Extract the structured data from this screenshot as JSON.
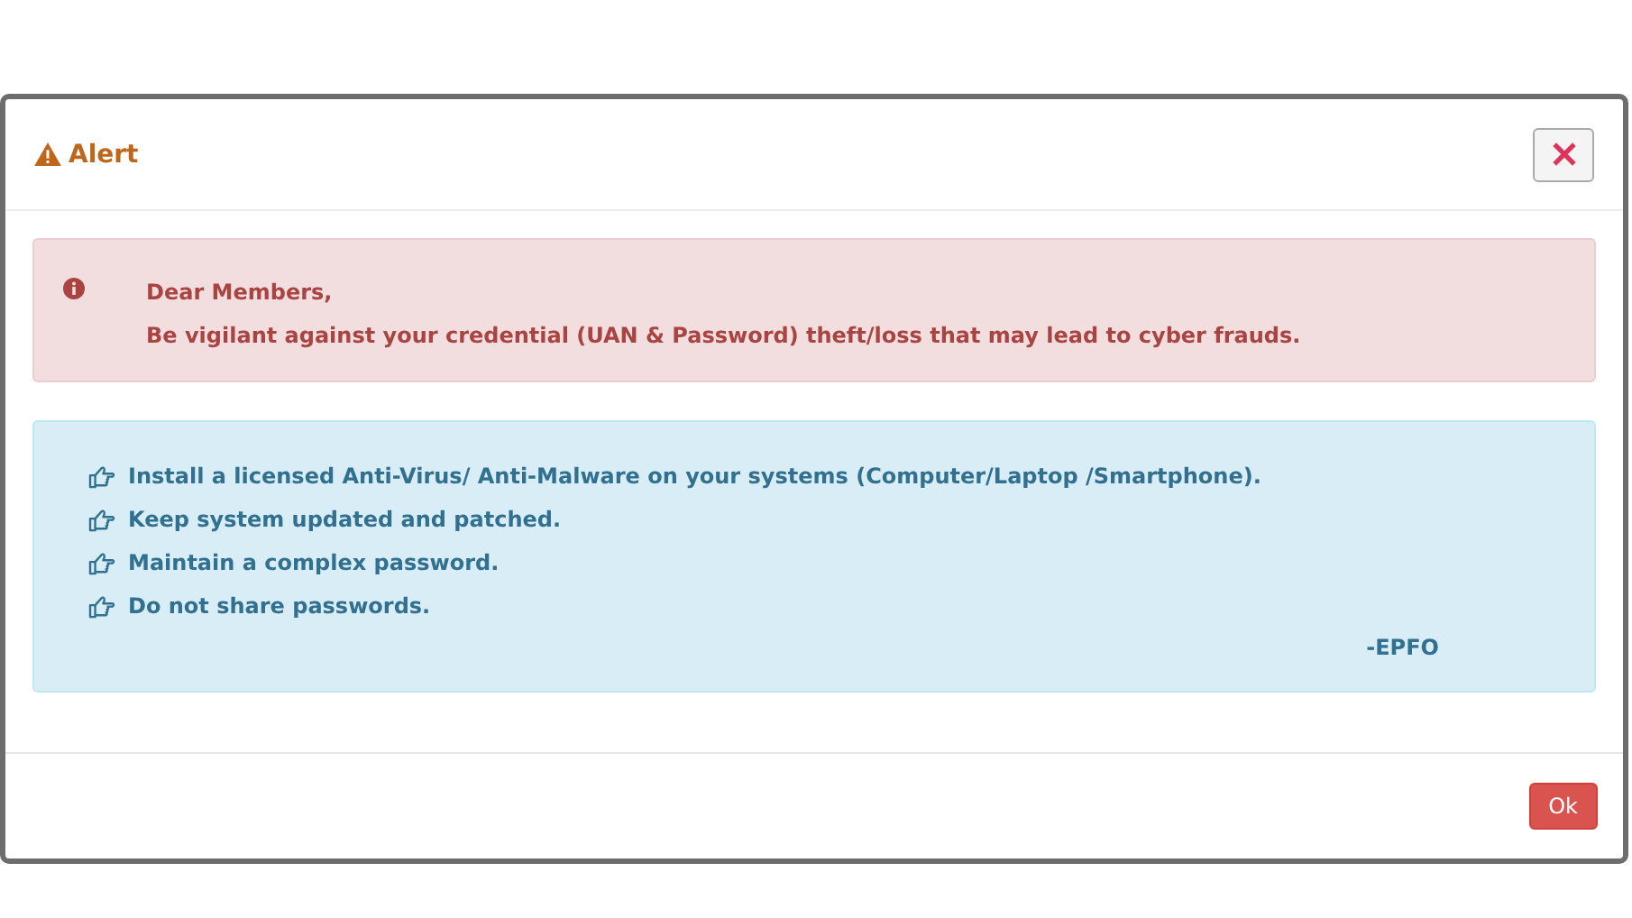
{
  "dialog": {
    "title": "Alert",
    "danger_alert": {
      "lines": [
        "Dear Members,",
        "Be vigilant against your credential (UAN & Password) theft/loss that may lead to cyber frauds."
      ]
    },
    "info_box": {
      "tips": [
        "Install a licensed Anti-Virus/ Anti-Malware on your systems (Computer/Laptop /Smartphone).",
        "Keep system updated and patched.",
        "Maintain a complex password.",
        "Do not share passwords."
      ],
      "signature": "-EPFO"
    },
    "buttons": [
      "Ok"
    ]
  }
}
